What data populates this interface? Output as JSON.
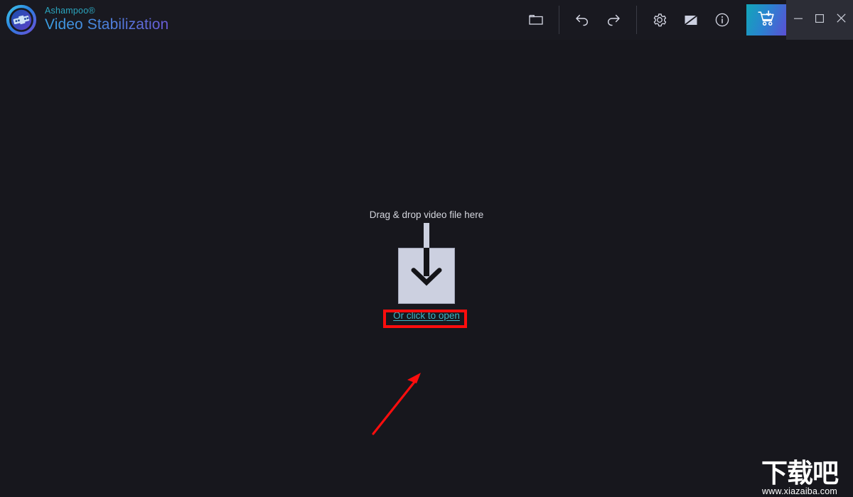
{
  "window": {
    "background_color": "#17171d",
    "titlebar_color": "#191920"
  },
  "brand": {
    "company": "Ashampoo®",
    "product": "Video Stabilization",
    "logo_icon": "film-strip-circle-logo",
    "company_color": "#2ba6bf",
    "product_gradient_from": "#3a9fe2",
    "product_gradient_to": "#6a5ad6"
  },
  "toolbar": {
    "items": [
      {
        "name": "open-file",
        "icon": "folder-icon",
        "label": "Open file"
      },
      {
        "name": "undo",
        "icon": "undo-arrow-icon",
        "label": "Undo"
      },
      {
        "name": "redo",
        "icon": "redo-arrow-icon",
        "label": "Redo"
      },
      {
        "name": "settings",
        "icon": "gear-icon",
        "label": "Settings"
      },
      {
        "name": "theme",
        "icon": "contrast-diagonal-icon",
        "label": "Theme"
      },
      {
        "name": "info",
        "icon": "info-circle-icon",
        "label": "Info"
      }
    ],
    "buy": {
      "name": "buy-now",
      "icon": "shopping-cart-download-icon",
      "label": "Buy",
      "gradient_from": "#12a6b8",
      "gradient_to": "#5b4fd4"
    }
  },
  "window_controls": [
    {
      "name": "minimize",
      "icon": "minimize-icon",
      "label": "Minimize"
    },
    {
      "name": "maximize",
      "icon": "maximize-icon",
      "label": "Maximize"
    },
    {
      "name": "close",
      "icon": "close-icon",
      "label": "Close"
    }
  ],
  "dropzone": {
    "hint": "Drag & drop video file here",
    "link": "Or click to open",
    "link_color": "#3fb5c6",
    "box_color": "#ccd0e0",
    "arrow_icon": "download-into-box-arrow-icon"
  },
  "annotations": {
    "highlight_color": "#fd0d0d",
    "rect_target": "Or click to open",
    "arrow_icon": "red-pointer-arrow"
  },
  "watermark": {
    "logo_text": "下载吧",
    "url": "www.xiazaiba.com"
  }
}
